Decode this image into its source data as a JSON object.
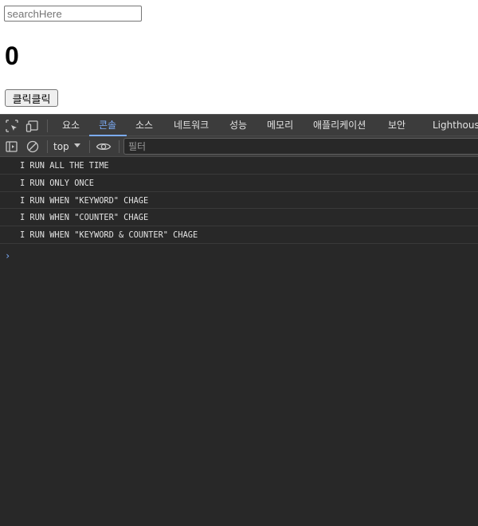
{
  "page": {
    "search": {
      "placeholder": "searchHere",
      "value": ""
    },
    "counter": "0",
    "button_label": "클릭클릭"
  },
  "devtools": {
    "icons": [
      "inspect-icon",
      "device-toggle-icon",
      "sidebar-icon",
      "clear-console-icon",
      "eye-icon"
    ],
    "tabs": [
      {
        "label": "요소",
        "active": false
      },
      {
        "label": "콘솔",
        "active": true
      },
      {
        "label": "소스",
        "active": false
      },
      {
        "label": "네트워크",
        "active": false
      },
      {
        "label": "성능",
        "active": false
      },
      {
        "label": "메모리",
        "active": false
      },
      {
        "label": "애플리케이션",
        "active": false
      },
      {
        "label": "보안",
        "active": false
      },
      {
        "label": "Lighthouse",
        "active": false
      }
    ],
    "context": "top",
    "filter": {
      "placeholder": "필터",
      "value": ""
    },
    "logs": [
      "I RUN ALL THE TIME",
      "I RUN ONLY ONCE",
      "I RUN WHEN \"KEYWORD\" CHAGE",
      "I RUN WHEN \"COUNTER\" CHAGE",
      "I RUN WHEN \"KEYWORD & COUNTER\" CHAGE"
    ],
    "prompt_symbol": "›",
    "accent_color": "#7cacf8"
  }
}
